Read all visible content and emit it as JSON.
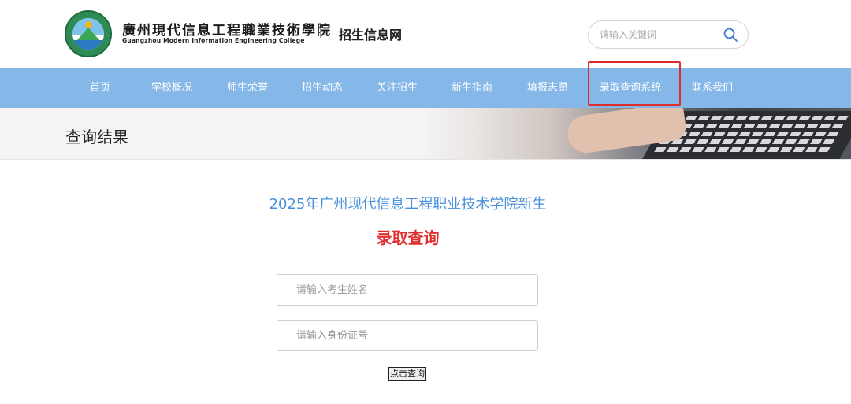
{
  "header": {
    "college_name_cn": "廣州現代信息工程職業技術學院",
    "college_name_en": "Guangzhou Modern Information Engineering College",
    "site_name": "招生信息网",
    "search": {
      "placeholder": "请输入关键词",
      "value": ""
    }
  },
  "nav": {
    "items": [
      {
        "label": "首页"
      },
      {
        "label": "学校概况"
      },
      {
        "label": "师生荣誉"
      },
      {
        "label": "招生动态"
      },
      {
        "label": "关注招生"
      },
      {
        "label": "新生指南"
      },
      {
        "label": "填报志愿"
      },
      {
        "label": "录取查询系统"
      },
      {
        "label": "联系我们"
      }
    ],
    "highlighted_index": 7,
    "highlight_color": "#e02b2b",
    "bar_color": "#85b7e8"
  },
  "banner": {
    "title": "查询结果"
  },
  "main": {
    "title": "2025年广州现代信息工程职业技术学院新生",
    "subtitle": "录取查询",
    "title_color": "#4a90d9",
    "subtitle_color": "#e03030",
    "form": {
      "name_placeholder": "请输入考生姓名",
      "name_value": "",
      "id_placeholder": "请输入身份证号",
      "id_value": "",
      "submit_label": "点击查询"
    }
  },
  "icons": {
    "search": "search-icon",
    "logo": "college-logo"
  }
}
